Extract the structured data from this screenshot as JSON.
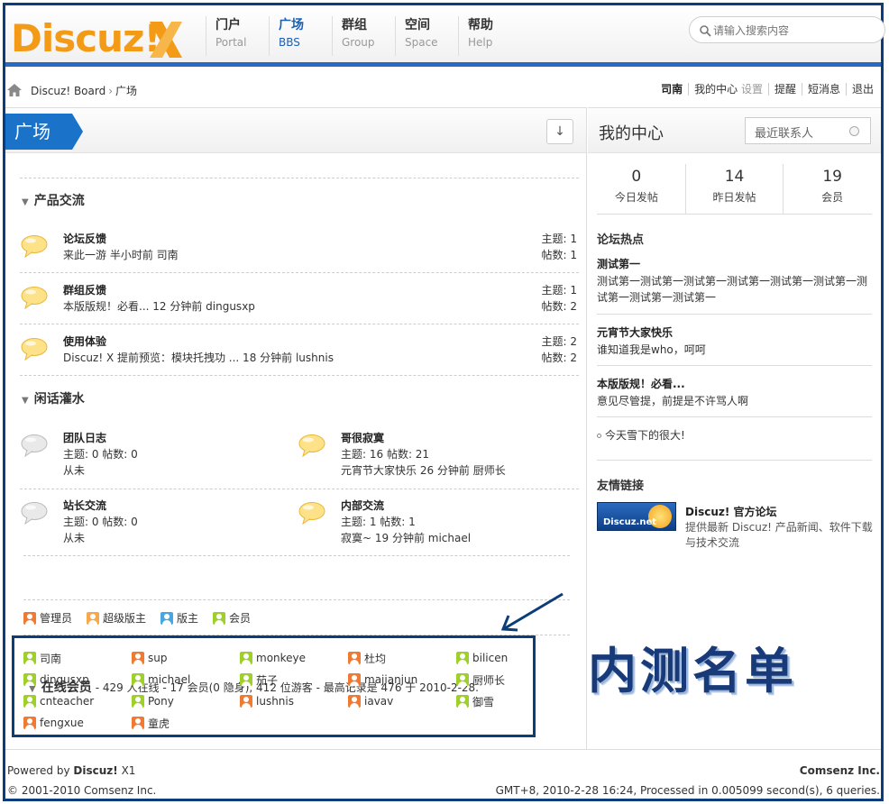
{
  "header": {
    "logo_text": "Discuz!",
    "nav": [
      {
        "zh": "门户",
        "en": "Portal"
      },
      {
        "zh": "广场",
        "en": "BBS"
      },
      {
        "zh": "群组",
        "en": "Group"
      },
      {
        "zh": "空间",
        "en": "Space"
      },
      {
        "zh": "帮助",
        "en": "Help"
      }
    ],
    "search_placeholder": "请输入搜索内容",
    "brand_colors": {
      "accent": "#1a73c9",
      "logo": "#f39a17",
      "frame": "#0b3d7a"
    }
  },
  "breadcrumb": {
    "root": "Discuz! Board",
    "separator": "›",
    "current": "广场"
  },
  "userbar": {
    "username": "司南",
    "center": "我的中心",
    "settings": "设置",
    "remind": "提醒",
    "messages": "短消息",
    "logout": "退出"
  },
  "main": {
    "tag": "广场",
    "collapse": "↓",
    "categories": [
      {
        "title": "产品交流",
        "forums": [
          {
            "name": "论坛反馈",
            "last": "来此一游 半小时前 司南",
            "threads": "主题: 1",
            "posts": "帖数: 1"
          },
          {
            "name": "群组反馈",
            "last": "本版版规！必看... 12 分钟前 dingusxp",
            "threads": "主题: 1",
            "posts": "帖数: 2"
          },
          {
            "name": "使用体验",
            "last": "Discuz! X 提前预览：模块托拽功 ... 18 分钟前 lushnis",
            "threads": "主题: 2",
            "posts": "帖数: 2"
          }
        ]
      },
      {
        "title": "闲话灌水",
        "forums": [
          {
            "name": "团队日志",
            "stats": "主题: 0 帖数: 0",
            "last": "从未"
          },
          {
            "name": "哥很寂寞",
            "stats": "主题: 16 帖数: 21",
            "last": "元宵节大家快乐 26 分钟前 厨师长"
          },
          {
            "name": "站长交流",
            "stats": "主题: 0 帖数: 0",
            "last": "从未"
          },
          {
            "name": "内部交流",
            "stats": "主题: 1 帖数: 1",
            "last": "寂寞~ 19 分钟前 michael"
          }
        ]
      }
    ],
    "online": {
      "title": "在线会员",
      "summary": "- 429 人在线 - 17 会员(0 隐身), 412 位游客 - 最高记录是 476 于 2010-2-28."
    },
    "legend": [
      {
        "label": "管理员",
        "color": "#f07a32"
      },
      {
        "label": "超级版主",
        "color": "#f6a94a"
      },
      {
        "label": "版主",
        "color": "#48a6e0"
      },
      {
        "label": "会员",
        "color": "#9fcf2a"
      }
    ],
    "members": [
      {
        "name": "司南",
        "color": "#9fcf2a"
      },
      {
        "name": "sup",
        "color": "#f07a32"
      },
      {
        "name": "monkeye",
        "color": "#9fcf2a"
      },
      {
        "name": "杜均",
        "color": "#f07a32"
      },
      {
        "name": "bilicen",
        "color": "#9fcf2a"
      },
      {
        "name": "dingusxp",
        "color": "#9fcf2a"
      },
      {
        "name": "michael",
        "color": "#9fcf2a"
      },
      {
        "name": "茄子",
        "color": "#9fcf2a"
      },
      {
        "name": "majianjun",
        "color": "#f07a32"
      },
      {
        "name": "厨师长",
        "color": "#9fcf2a"
      },
      {
        "name": "cnteacher",
        "color": "#9fcf2a"
      },
      {
        "name": "Pony",
        "color": "#9fcf2a"
      },
      {
        "name": "lushnis",
        "color": "#f07a32"
      },
      {
        "name": "iavav",
        "color": "#f07a32"
      },
      {
        "name": "御雪",
        "color": "#9fcf2a"
      },
      {
        "name": "fengxue",
        "color": "#f07a32"
      },
      {
        "name": "童虎",
        "color": "#f07a32"
      }
    ],
    "annotation": "内测名单"
  },
  "side": {
    "title": "我的中心",
    "contacts": "最近联系人",
    "stats": [
      {
        "num": "0",
        "label": "今日发帖"
      },
      {
        "num": "14",
        "label": "昨日发帖"
      },
      {
        "num": "19",
        "label": "会员"
      }
    ],
    "hot_title": "论坛热点",
    "hot": [
      {
        "title": "测试第一",
        "desc": "测试第一测试第一测试第一测试第一测试第一测试第一测试第一测试第一测试第一"
      },
      {
        "title": "元宵节大家快乐",
        "desc": "谁知道我是who，呵呵"
      },
      {
        "title": "本版版规！必看...",
        "desc": "意见尽管提，前提是不许骂人啊"
      }
    ],
    "hot_bullet": "今天雪下的很大!",
    "links_title": "友情链接",
    "link": {
      "logo_text": "Discuz.net",
      "name": "Discuz! 官方论坛",
      "desc": "提供最新 Discuz! 产品新闻、软件下载与技术交流"
    }
  },
  "footer": {
    "powered_prefix": "Powered by",
    "powered_brand": "Discuz!",
    "powered_version": "X1",
    "copyright": "© 2001-2010 Comsenz Inc.",
    "company": "Comsenz Inc.",
    "status": "GMT+8, 2010-2-28 16:24, Processed in 0.005099 second(s), 6 queries."
  }
}
